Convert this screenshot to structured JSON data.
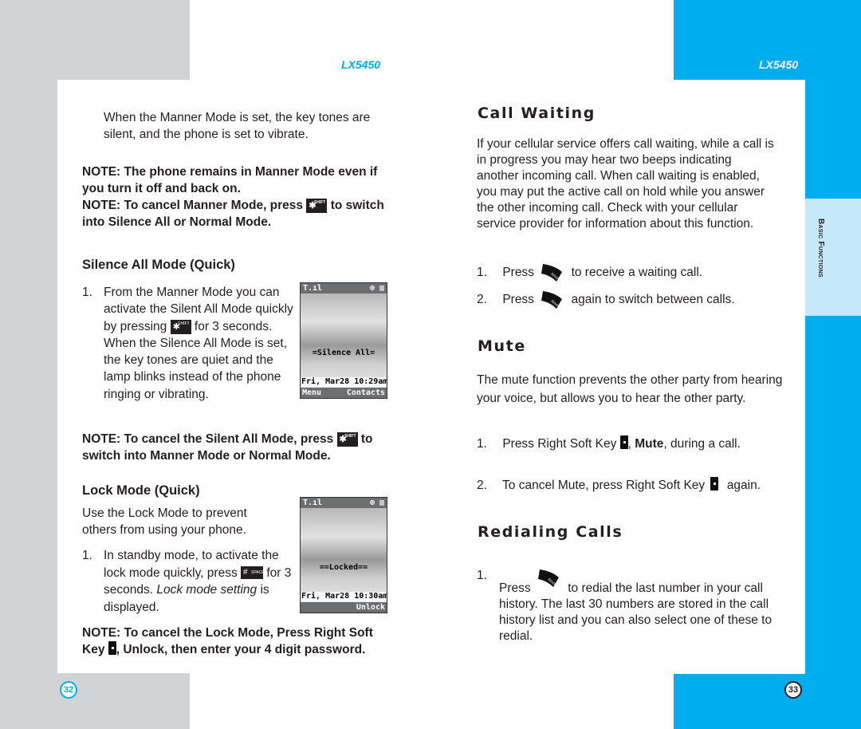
{
  "left_page": {
    "model": "LX5450",
    "page_number": "32",
    "intro": "When the Manner Mode is set, the key tones are silent, and the phone is set to vibrate.",
    "note1": "NOTE: The phone remains in Manner Mode even if you turn it off and back on.",
    "note2_a": "NOTE: To cancel Manner Mode, press",
    "note2_b": "to switch into Silence All or Normal Mode.",
    "silence_heading": "Silence All Mode (Quick)",
    "silence_step_num": "1.",
    "silence_step_a": "From the Manner Mode you can activate the Silent All Mode quickly by pressing",
    "silence_step_b": "for 3 seconds.",
    "silence_step_c": "When the Silence All Mode is set, the key tones are quiet and the lamp blinks instead of the phone ringing or vibrating.",
    "note3_a": "NOTE: To cancel the Silent All Mode, press",
    "note3_b": "to switch into Manner Mode or Normal Mode.",
    "lock_heading": "Lock Mode (Quick)",
    "lock_intro": "Use the Lock Mode to prevent others from using your phone.",
    "lock_step_num": "1.",
    "lock_step_a": "In standby mode, to activate the lock mode quickly, press",
    "lock_step_b": "for 3 seconds.",
    "lock_step_italic": "Lock mode setting",
    "lock_step_c": "is displayed.",
    "note4_a": "NOTE: To cancel the Lock Mode, Press Right Soft Key",
    "note4_b": ", Unlock, then enter your 4 digit password.",
    "keys": {
      "star_main": "✱",
      "star_sub": "SHIFT",
      "hash_main": "#",
      "hash_sub": "SPACE"
    },
    "screen1": {
      "signal": "T.ıl",
      "status_icons": "⊕ ▥",
      "banner": "=Silence All=",
      "date": "Fri, Mar28 10:29am",
      "left_soft": "Menu",
      "right_soft": "Contacts"
    },
    "screen2": {
      "signal": "T.ıl",
      "status_icons": "⊕ ▥",
      "banner": "==Locked==",
      "date": "Fri, Mar28 10:30am",
      "left_soft": "",
      "right_soft": "Unlock"
    }
  },
  "right_page": {
    "model": "LX5450",
    "page_number": "33",
    "side_tab": "Basic Functions",
    "call_waiting": {
      "heading": "Call Waiting",
      "body": "If your cellular service offers call waiting, while a call is in progress you may hear two beeps indicating another incoming call. When call waiting is enabled, you may put the active call on hold while you answer the other incoming call. Check with your cellular service provider for information about this function.",
      "steps": [
        {
          "num": "1.",
          "before": "Press",
          "after": "to receive a waiting call."
        },
        {
          "num": "2.",
          "before": "Press",
          "after": "again to switch between calls."
        }
      ]
    },
    "mute": {
      "heading": "Mute",
      "body": "The mute function prevents the other party from hearing your voice, but allows you to hear the other party.",
      "step1_num": "1.",
      "step1_a": "Press Right Soft Key",
      "step1_bold": "Mute",
      "step1_b": ", during a call.",
      "step1_comma": ",",
      "step2_num": "2.",
      "step2_a": "To cancel Mute, press Right Soft Key",
      "step2_b": "again."
    },
    "redialing": {
      "heading": "Redialing Calls",
      "step_num": "1.",
      "step_a": "Press",
      "step_b": "to redial the last number in your call history. The last 30 numbers are stored in the call history list and you can also select one of these to redial."
    },
    "send_key_label": "SEND"
  },
  "colors": {
    "accent_blue": "#00aeef",
    "frame_gray": "#d1d3d4",
    "tab_light_blue": "#c6e9fa",
    "text": "#231f20"
  }
}
